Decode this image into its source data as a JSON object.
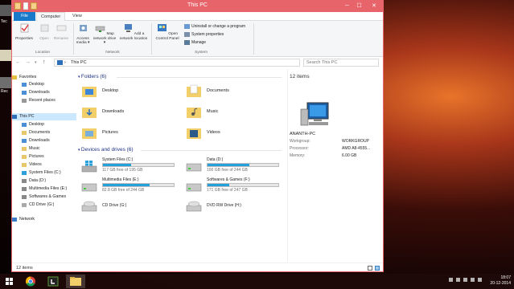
{
  "window": {
    "title": "This PC",
    "min": "─",
    "max": "☐",
    "close": "✕"
  },
  "tabs": [
    "File",
    "Computer",
    "View"
  ],
  "ribbon": {
    "location": {
      "label": "Location",
      "buttons": [
        "Properties",
        "Open",
        "Rename"
      ]
    },
    "network": {
      "label": "Network",
      "buttons": [
        "Access media ▾",
        "Map network drive ▾",
        "Add a network location"
      ]
    },
    "system": {
      "label": "System",
      "open_cp": "Open Control Panel",
      "small": [
        "Uninstall or change a program",
        "System properties",
        "Manage"
      ]
    }
  },
  "address": {
    "path": "This PC",
    "sep": "›",
    "search_placeholder": "Search This PC"
  },
  "nav": {
    "favorites": "Favorites",
    "fav_items": [
      "Desktop",
      "Downloads",
      "Recent places"
    ],
    "this_pc": "This PC",
    "pc_items": [
      "Desktop",
      "Documents",
      "Downloads",
      "Music",
      "Pictures",
      "Videos",
      "System Files (C:)",
      "Data (D:)",
      "Multimedia Files (E:)",
      "Softwares & Games",
      "CD Drive (G:)"
    ],
    "network": "Network"
  },
  "content": {
    "folders_header": "Folders (6)",
    "folders": [
      "Desktop",
      "Documents",
      "Downloads",
      "Music",
      "Pictures",
      "Videos"
    ],
    "drives_header": "Devices and drives (6)",
    "drives": [
      {
        "name": "System Files (C:)",
        "free": "117 GB free of 195 GB",
        "used_fraction": 0.4
      },
      {
        "name": "Data (D:)",
        "free": "100 GB free of 244 GB",
        "used_fraction": 0.59
      },
      {
        "name": "Multimedia Files (E:)",
        "free": "82.8 GB free of 244 GB",
        "used_fraction": 0.66
      },
      {
        "name": "Softwares & Games (F:)",
        "free": "171 GB free of 247 GB",
        "used_fraction": 0.31
      },
      {
        "name": "CD Drive (G:)"
      },
      {
        "name": "DVD RW Drive (H:)"
      }
    ]
  },
  "details": {
    "count": "12 items",
    "pc_name": "ANANTH-PC",
    "workgroup_label": "Workgroup:",
    "workgroup": "WORKGROUP",
    "processor_label": "Processor:",
    "processor": "AMD A8-4555...",
    "memory_label": "Memory:",
    "memory": "6.00 GB"
  },
  "status": {
    "count": "12 items"
  },
  "taskbar": {
    "time": "18:07",
    "date": "20-12-2014"
  },
  "colors": {
    "title_accent": "#e6646a",
    "file_tab": "#1979ca",
    "drive_fill": "#26a0da",
    "nav_selected": "#cce8ff"
  }
}
